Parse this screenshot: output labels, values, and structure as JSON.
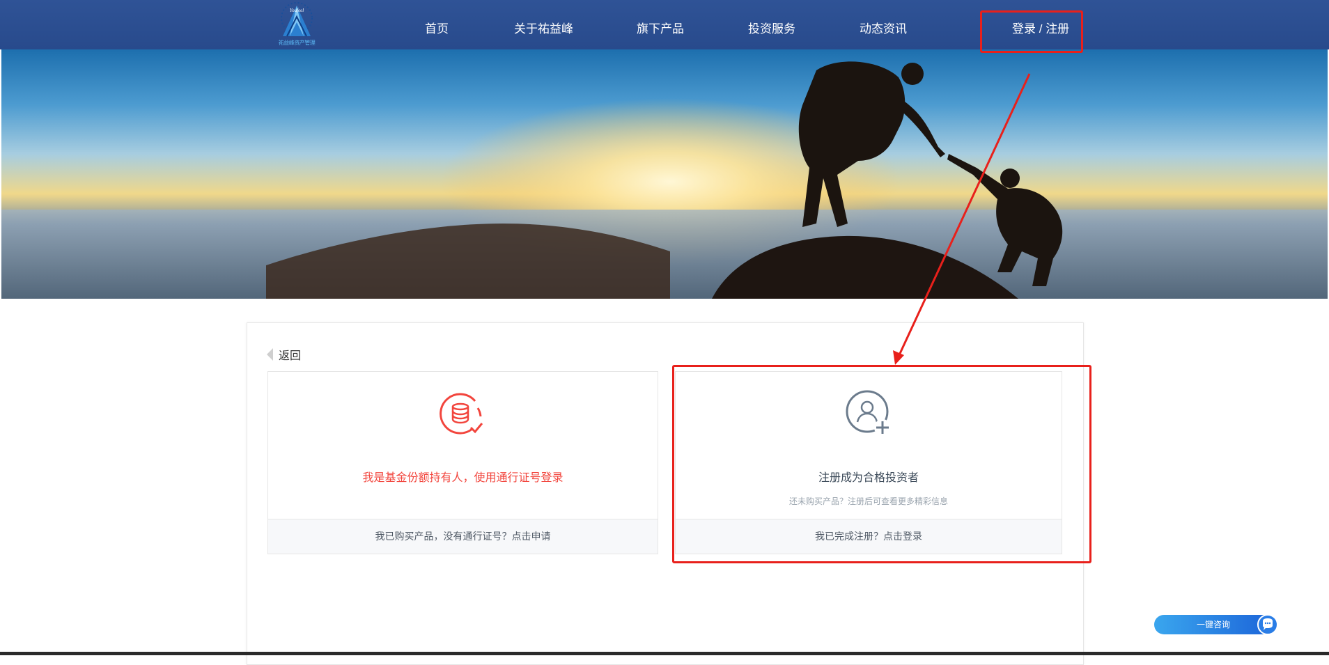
{
  "brand": {
    "logo_text": "祐益峰资产管理",
    "logo_script": "Youfeel"
  },
  "nav": {
    "items": [
      "首页",
      "关于祐益峰",
      "旗下产品",
      "投资服务",
      "动态资讯"
    ],
    "login_register": "登录 / 注册"
  },
  "page": {
    "back_label": "返回",
    "holder_card": {
      "icon": "fund-database-check-icon",
      "title": "我是基金份额持有人，使用通行证号登录",
      "footer": "我已购买产品，没有通行证号？点击申请"
    },
    "register_card": {
      "icon": "user-add-icon",
      "title": "注册成为合格投资者",
      "subtitle": "还未购买产品？注册后可查看更多精彩信息",
      "footer": "我已完成注册？点击登录"
    }
  },
  "consult": {
    "label": "一键咨询",
    "icon": "chat-bubble-icon"
  },
  "colors": {
    "nav_bg": "#2f5396",
    "accent_red": "#f2453d",
    "annotation_red": "#e8201b",
    "consult_blue": "#1b62d8"
  }
}
